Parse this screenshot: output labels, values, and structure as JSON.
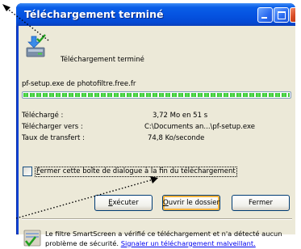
{
  "window": {
    "title": "Téléchargement terminé"
  },
  "header": {
    "message": "Téléchargement terminé",
    "icon": "download-complete-icon"
  },
  "download": {
    "file_line": "pf-setup.exe de photofiltre.free.fr",
    "progress_fraction": 1.0,
    "progress_color": "#2fc02a",
    "rows": [
      {
        "label": "Téléchargé :",
        "value": "3,72 Mo en 51 s"
      },
      {
        "label": "Télécharger vers :",
        "value": "C:\\Documents an...\\pf-setup.exe"
      },
      {
        "label": "Taux de transfert :",
        "value": "74,8 Ko/seconde"
      }
    ]
  },
  "options": {
    "close_on_finish": {
      "checked": false,
      "access_key": "F",
      "label_rest": "ermer cette boîte de dialogue à la fin du téléchargement"
    }
  },
  "buttons": {
    "execute": {
      "access_key": "E",
      "rest": "xécuter"
    },
    "open_folder": {
      "access_key": "O",
      "rest": "uvrir le dossier"
    },
    "close": {
      "label": "Fermer"
    }
  },
  "smartscreen": {
    "text": "Le filtre SmartScreen a vérifié ce téléchargement et n'a détecté aucun problème de sécurité.",
    "link": "Signaler un téléchargement malveillant."
  },
  "colors": {
    "titlebar": "#0552e0",
    "client_bg": "#ece9d8",
    "focus_ring": "#f8b33c",
    "link": "#0000ee"
  }
}
